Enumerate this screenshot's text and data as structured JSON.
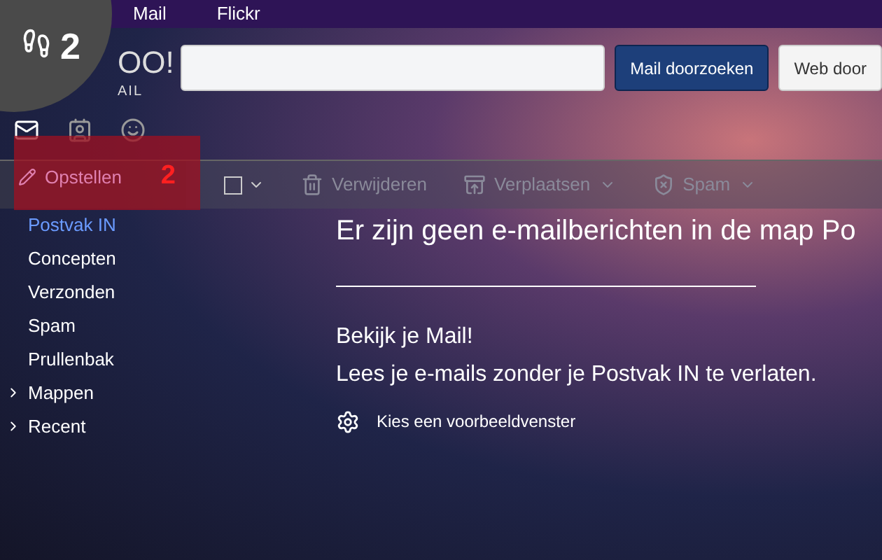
{
  "top_nav": [
    {
      "label": "Mail"
    },
    {
      "label": "Flickr"
    }
  ],
  "step_badge": {
    "number": "2"
  },
  "logo": {
    "word": "OO!",
    "sub": "AIL"
  },
  "search": {
    "buttons": [
      {
        "label": "Mail doorzoeken",
        "kind": "primary"
      },
      {
        "label": "Web door",
        "kind": "secondary"
      }
    ]
  },
  "app_icons": [
    {
      "kind": "mail",
      "selected": true
    },
    {
      "kind": "contacts",
      "selected": false
    },
    {
      "kind": "messenger",
      "selected": false
    }
  ],
  "compose": {
    "label": "Opstellen",
    "highlighted": true,
    "annotation": "2"
  },
  "select_all": {
    "checked": false
  },
  "toolbar": [
    {
      "label": "Verwijderen",
      "kind": "delete",
      "dropdown": false
    },
    {
      "label": "Verplaatsen",
      "kind": "move",
      "dropdown": true
    },
    {
      "label": "Spam",
      "kind": "spam",
      "dropdown": true
    }
  ],
  "folders": [
    {
      "label": "Postvak IN",
      "selected": true,
      "expandable": false
    },
    {
      "label": "Concepten",
      "selected": false,
      "expandable": false
    },
    {
      "label": "Verzonden",
      "selected": false,
      "expandable": false
    },
    {
      "label": "Spam",
      "selected": false,
      "expandable": false
    },
    {
      "label": "Prullenbak",
      "selected": false,
      "expandable": false
    },
    {
      "label": "Mappen",
      "selected": false,
      "expandable": true
    },
    {
      "label": "Recent",
      "selected": false,
      "expandable": true
    }
  ],
  "content": {
    "empty_message": "Er zijn geen e-mailberichten in de map Po",
    "heading": "Bekijk je Mail!",
    "subtext": "Lees je e-mails zonder je Postvak IN te verlaten.",
    "link": "Kies een voorbeeldvenster"
  }
}
